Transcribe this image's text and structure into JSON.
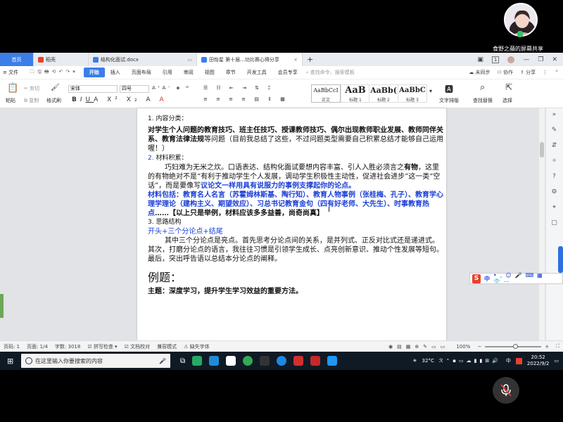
{
  "presenter": {
    "caption": "食野之蘋的屏幕共享"
  },
  "tabs": [
    {
      "label": "首页",
      "kind": "home"
    },
    {
      "label": "稻壳",
      "kind": "docer"
    },
    {
      "label": "结构化面试.docx",
      "kind": "doc"
    },
    {
      "label": "田怡星 第十届...功比赛心得分享",
      "kind": "doc-active"
    }
  ],
  "window_controls": {
    "new_tab": "+",
    "count": "1"
  },
  "menu": {
    "file": "文件",
    "items": [
      "开始",
      "插入",
      "页面布局",
      "引用",
      "审阅",
      "视图",
      "章节",
      "开发工具",
      "会员专享"
    ],
    "search_placeholder": "查找命令、搜索模板",
    "right": [
      "未同步",
      "协作",
      "分享"
    ]
  },
  "ribbon": {
    "paste": "粘贴",
    "cut": "剪切",
    "copy": "复制",
    "format_painter": "格式刷",
    "font_name": "宋体",
    "font_size": "四号",
    "styles": [
      {
        "preview": "AaBbCcI",
        "label": "正文"
      },
      {
        "preview": "AaB",
        "label": "标题 1"
      },
      {
        "preview": "AaBb(",
        "label": "标题 2"
      },
      {
        "preview": "AaBbC",
        "label": "标题 3"
      }
    ],
    "text_layout": "文字排版",
    "find_replace": "查找替换",
    "select": "选择"
  },
  "document": {
    "h1": "1. 内容分类：",
    "p1_bold": "对学生个人问题的教育技巧、班主任技巧、授课教师技巧、偶尔出现教师职业发展、教师同伴关系、教育法律法规",
    "p1_rest": "等问题（目前我总结了这些，不过问题类型需要自己积累总结才能够自己运用喔！）",
    "h2_num": "2.",
    "h2": " 材料积累：",
    "p2_a": "巧妇难为无米之炊。口语表达、结构化面试要想内容丰富、引人入胜必须言之",
    "p2_b": "有物",
    "p2_c": "，这里的有物绝对不是“有利于推动学生个人发展，调动学生积极性主动性，促进社会进步”这一类“空话”，而是要像写",
    "p2_d": "议论文一样用具有说服力的事例支撑起你的论点。",
    "p3_blue": "材料包括：教育名人名言（苏霍姆林斯基、陶行知）、教育人物事例（张桂梅、孔子）、教育学心理学理论（建构主义、期望效应）、习总书记教育金句（四有好老师、大先生）、时事教育热点",
    "p3_rest": "……【以上只是举例，材料应该多多益善，尚奇尚真】",
    "h3": "3. 思路结构",
    "h3_sub": "开头+三个分论点+结尾",
    "p4": "其中三个分论点是亮点。首先思考分论点间的关系，是并列式、正反对比式还是递进式。其次，打磨分论点的语言，我往往习惯是引领学生成长、点亮创新意识、推动个性发展等短句。最后，突出呼告语以总结本分论点的阐释。",
    "h4": "例题：",
    "theme": "主题：深度学习，提升学生学习效益的重要方法。"
  },
  "status": {
    "page_num": "页码: 1",
    "pages": "页面: 1/4",
    "words": "字数: 3018",
    "spell": "拼写检查",
    "proof": "文档校对",
    "compat": "兼容模式",
    "missing_font": "缺失字体",
    "zoom": "100%",
    "zoom_level": 0.5
  },
  "ime": {
    "mode": "中"
  },
  "taskbar": {
    "search_placeholder": "在这里输入你要搜索的内容",
    "temp": "32°C",
    "lang": "中",
    "time": "20:52",
    "date": "2022/9/2"
  },
  "colors": {
    "accent": "#3c7ee8",
    "doc_blue": "#1a3fd6",
    "taskbar": "#101a25"
  }
}
